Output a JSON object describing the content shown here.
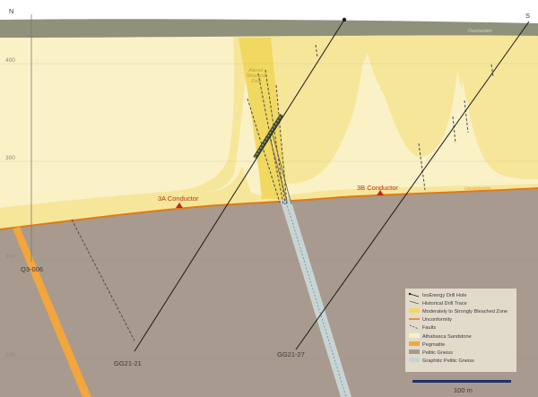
{
  "orientation": {
    "north": "N",
    "south": "S"
  },
  "elevations": [
    "400",
    "300",
    "200",
    "100"
  ],
  "labels": {
    "overburden": "Overburden",
    "unconformity": "Unconformity",
    "altered_zone": [
      "Altered",
      "Structural",
      "Zone"
    ],
    "conductor_3a": "3A Conductor",
    "conductor_3b": "3B Conductor"
  },
  "drill_holes": {
    "q3_006": "Q3-006",
    "gg21_21": "GG21-21",
    "gg21_27": "GG21-27"
  },
  "legend": [
    {
      "label": "IsoEnergy Drill Hole",
      "icon": "isoenergy-drill-hole-icon"
    },
    {
      "label": "Historical Drill Trace",
      "icon": "historical-drill-trace-icon"
    },
    {
      "label": "Moderately to Strongly Bleached Zone",
      "icon": "bleached-zone-swatch",
      "color": "#f1d860"
    },
    {
      "label": "Unconformity",
      "icon": "unconformity-line-icon",
      "color": "#e07a1a"
    },
    {
      "label": "Faults",
      "icon": "fault-line-icon"
    },
    {
      "label": "Athabasca Sandstone",
      "icon": "sandstone-swatch",
      "color": "#fbf1c7"
    },
    {
      "label": "Pegmatite",
      "icon": "pegmatite-swatch",
      "color": "#f3a63c"
    },
    {
      "label": "Pelitic Gneiss",
      "icon": "pelitic-gneiss-swatch",
      "color": "#a89a8e"
    },
    {
      "label": "Graphitic Pelitic Gneiss",
      "icon": "graphitic-gneiss-swatch",
      "color": "#c8d4d4"
    }
  ],
  "scale_bar": "100 m",
  "colors": {
    "overburden": "#8f917b",
    "sandstone": "#fbf1c7",
    "bleached": "#f6e69a",
    "bleached_strong": "#f1d860",
    "basement": "#a89a8e",
    "unconformity": "#e07a1a",
    "pegmatite": "#f3a63c",
    "graphitic": "#c8d4d4",
    "conductor": "#c0281a"
  }
}
